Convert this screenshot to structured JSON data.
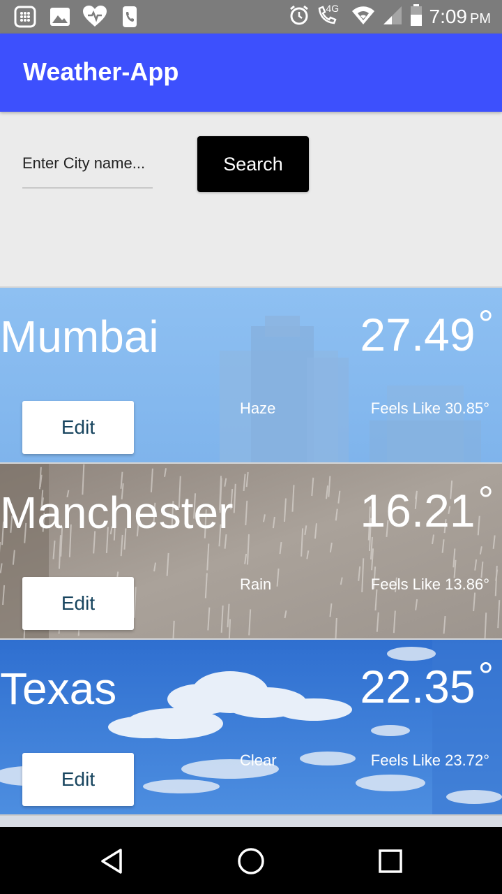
{
  "status_bar": {
    "time": "7:09",
    "ampm": "PM",
    "network": "4G",
    "icons": [
      "calculator-icon",
      "gallery-icon",
      "health-icon",
      "phone-icon",
      "alarm-icon",
      "wifi-call-icon",
      "wifi-icon",
      "signal-icon",
      "battery-icon"
    ]
  },
  "app_bar": {
    "title": "Weather-App"
  },
  "search": {
    "placeholder": "Enter City name...",
    "value": "",
    "button_label": "Search"
  },
  "cards": [
    {
      "city": "Mumbai",
      "temp": "27.49",
      "degree": "°",
      "condition": "Haze",
      "feels_like": "Feels Like 30.85°",
      "edit_label": "Edit",
      "theme": "haze"
    },
    {
      "city": "Manchester",
      "temp": "16.21",
      "degree": "°",
      "condition": "Rain",
      "feels_like": "Feels Like 13.86°",
      "edit_label": "Edit",
      "theme": "rain"
    },
    {
      "city": "Texas",
      "temp": "22.35",
      "degree": "°",
      "condition": "Clear",
      "feels_like": "Feels Like 23.72°",
      "edit_label": "Edit",
      "theme": "clear"
    }
  ],
  "colors": {
    "app_bar": "#3d50fd",
    "status_bar": "#7c7c7c",
    "search_button": "#000000",
    "edit_text": "#18455f"
  },
  "nav_bar": {
    "icons": [
      "back-icon",
      "home-icon",
      "recents-icon"
    ]
  }
}
